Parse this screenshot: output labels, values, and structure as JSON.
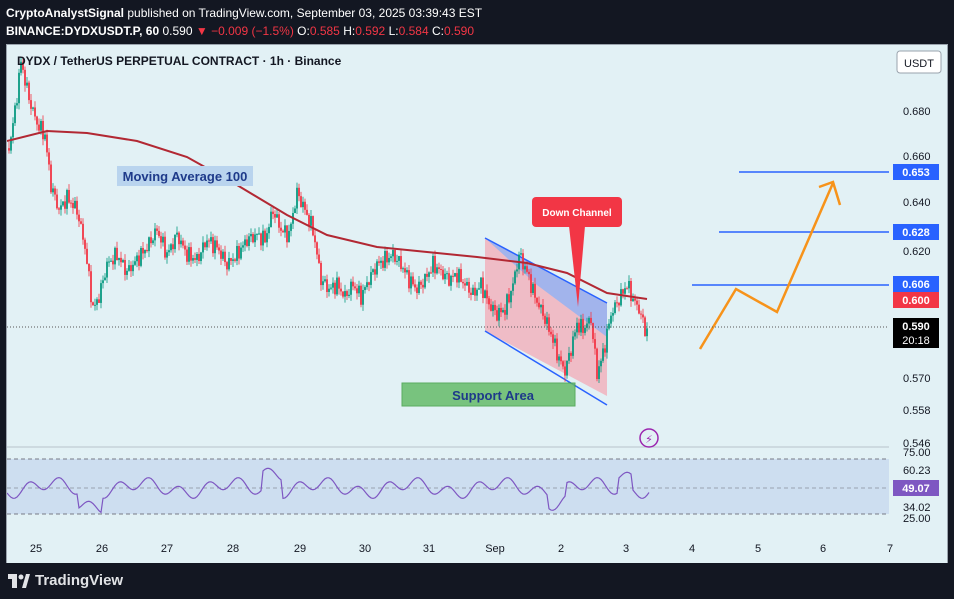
{
  "header": {
    "author": "CryptoAnalystSignal",
    "published": "published on TradingView.com, September 03, 2025 03:39:43 EST",
    "symbol": "BINANCE:DYDXUSDT.P, 60",
    "price": "0.590",
    "change": "▼ −0.009 (−1.5%)",
    "o_label": "O:",
    "o_value": "0.585",
    "h_label": "H:",
    "h_value": "0.592",
    "l_label": "L:",
    "l_value": "0.584",
    "c_label": "C:",
    "c_value": "0.590"
  },
  "chart": {
    "title": "DYDX / TetherUS PERPETUAL CONTRACT · 1h · Binance",
    "currency_button": "USDT",
    "price_ticks": [
      "0.680",
      "0.660",
      "0.640",
      "0.620",
      "0.570",
      "0.558",
      "0.546"
    ],
    "price_badges": [
      {
        "value": "0.653",
        "color": "#2962ff"
      },
      {
        "value": "0.628",
        "color": "#2962ff"
      },
      {
        "value": "0.606",
        "color": "#2962ff"
      },
      {
        "value": "0.600",
        "color": "#f23645"
      },
      {
        "value": "0.590",
        "color": "#000000"
      }
    ],
    "countdown": "20:18",
    "rsi_ticks": [
      "75.00",
      "60.23",
      "34.02",
      "25.00"
    ],
    "rsi_badge": "49.07",
    "x_labels": [
      "25",
      "26",
      "27",
      "28",
      "29",
      "30",
      "31",
      "Sep",
      "2",
      "3",
      "4",
      "5",
      "6",
      "7"
    ],
    "annotations": {
      "moving_average": "Moving Average 100",
      "down_channel": "Down Channel",
      "support_area": "Support Area"
    },
    "colors": {
      "up": "#089981",
      "down": "#f23645",
      "ma": "#b22833",
      "level": "#2962ff",
      "projection": "#f7931a",
      "rsi": "#7e57c2"
    }
  },
  "footer": {
    "logo_text": "TradingView"
  }
}
